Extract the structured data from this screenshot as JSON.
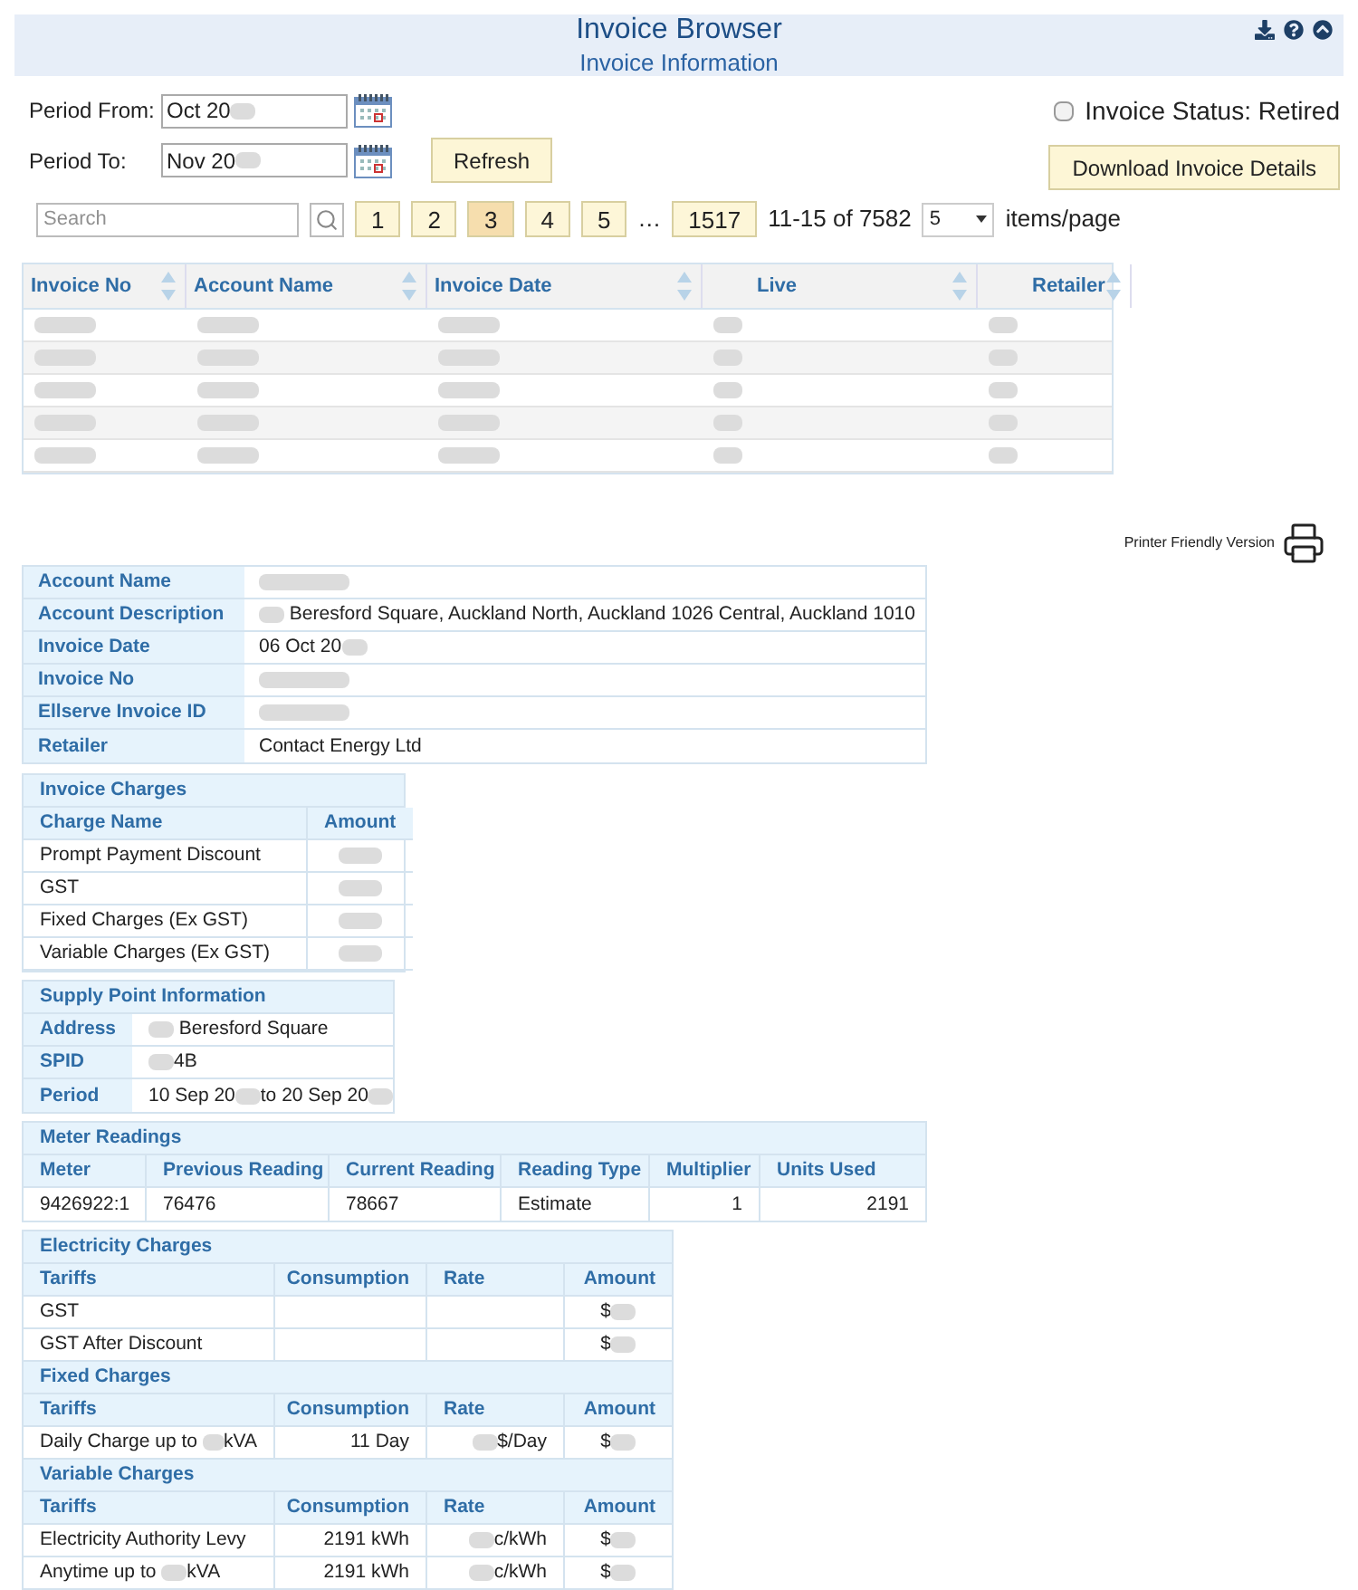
{
  "header": {
    "title": "Invoice Browser",
    "subtitle": "Invoice Information"
  },
  "filters": {
    "period_from": {
      "label": "Period From:",
      "value": [
        "Oct 20",
        {
          "kind": "blurred"
        }
      ]
    },
    "period_to": {
      "label": "Period To:",
      "value": [
        "Nov 20",
        {
          "kind": "blurred"
        }
      ]
    },
    "refresh": "Refresh",
    "status": {
      "label": "Invoice Status: Retired",
      "checked": false
    },
    "download": "Download Invoice Details"
  },
  "pager": {
    "search_placeholder": "Search",
    "pages": [
      {
        "label": "1",
        "selected": false
      },
      {
        "label": "2",
        "selected": false
      },
      {
        "label": "3",
        "selected": true
      },
      {
        "label": "4",
        "selected": false
      },
      {
        "label": "5",
        "selected": false
      }
    ],
    "ellipsis": "…",
    "last_page": {
      "label": "1517",
      "selected": false
    },
    "range": "11-15 of 7582",
    "page_size": "5",
    "page_size_suffix": "items/page"
  },
  "table": {
    "columns": [
      "Invoice No",
      "Account Name",
      "Invoice Date",
      "Live",
      "Retailer"
    ],
    "rows": [
      [
        {
          "kind": "blurred"
        },
        {
          "kind": "blurred"
        },
        {
          "kind": "blurred"
        },
        {
          "kind": "blurred"
        },
        {
          "kind": "blurred"
        }
      ],
      [
        {
          "kind": "blurred"
        },
        {
          "kind": "blurred"
        },
        {
          "kind": "blurred"
        },
        {
          "kind": "blurred"
        },
        {
          "kind": "blurred"
        }
      ],
      [
        {
          "kind": "blurred"
        },
        {
          "kind": "blurred"
        },
        {
          "kind": "blurred"
        },
        {
          "kind": "blurred"
        },
        {
          "kind": "blurred"
        }
      ],
      [
        {
          "kind": "blurred"
        },
        {
          "kind": "blurred"
        },
        {
          "kind": "blurred"
        },
        {
          "kind": "blurred"
        },
        {
          "kind": "blurred"
        }
      ],
      [
        {
          "kind": "blurred"
        },
        {
          "kind": "blurred"
        },
        {
          "kind": "blurred"
        },
        {
          "kind": "blurred"
        },
        {
          "kind": "blurred"
        }
      ]
    ]
  },
  "printer": "Printer Friendly Version",
  "account": [
    {
      "label": "Account Name",
      "value": {
        "kind": "blurred"
      }
    },
    {
      "label": "Account Description",
      "value": [
        {
          "kind": "blurred"
        },
        " Beresford Square, Auckland North, Auckland 1026 Central, Auckland 1010"
      ]
    },
    {
      "label": "Invoice Date",
      "value": [
        "06 Oct 20",
        {
          "kind": "blurred"
        }
      ]
    },
    {
      "label": "Invoice No",
      "value": {
        "kind": "blurred"
      }
    },
    {
      "label": "Ellserve Invoice ID",
      "value": {
        "kind": "blurred"
      }
    },
    {
      "label": "Retailer",
      "value": "Contact Energy Ltd"
    }
  ],
  "invoice_charges": {
    "title": "Invoice Charges",
    "columns": [
      "Charge Name",
      "Amount"
    ],
    "rows": [
      [
        "Prompt Payment Discount",
        {
          "kind": "blurred"
        }
      ],
      [
        "GST",
        {
          "kind": "blurred"
        }
      ],
      [
        "Fixed Charges (Ex GST)",
        {
          "kind": "blurred"
        }
      ],
      [
        "Variable Charges (Ex GST)",
        {
          "kind": "blurred"
        }
      ]
    ]
  },
  "supply_point": {
    "title": "Supply Point Information",
    "rows": [
      {
        "label": "Address",
        "value": [
          {
            "kind": "blurred"
          },
          " Beresford Square"
        ]
      },
      {
        "label": "SPID",
        "value": [
          {
            "kind": "blurred"
          },
          "4B"
        ]
      },
      {
        "label": "Period",
        "value": [
          "10 Sep 20",
          {
            "kind": "blurred"
          },
          "to 20 Sep 20",
          {
            "kind": "blurred"
          }
        ]
      }
    ]
  },
  "meter_readings": {
    "title": "Meter Readings",
    "columns": [
      "Meter",
      "Previous Reading",
      "Current Reading",
      "Reading Type",
      "Multiplier",
      "Units Used"
    ],
    "rows": [
      [
        "9426922:1",
        "76476",
        "78667",
        "Estimate",
        "1",
        "2191"
      ]
    ]
  },
  "charge_sections": [
    {
      "title": "Electricity Charges",
      "columns": [
        "Tariffs",
        "Consumption",
        "Rate",
        "Amount"
      ],
      "rows": [
        {
          "tariff": "GST",
          "amount": [
            "$",
            {
              "kind": "blurred"
            }
          ]
        },
        {
          "tariff": "GST After Discount",
          "amount": [
            "$",
            {
              "kind": "blurred"
            }
          ]
        }
      ]
    },
    {
      "title": "Fixed Charges",
      "columns": [
        "Tariffs",
        "Consumption",
        "Rate",
        "Amount"
      ],
      "rows": [
        {
          "tariff": [
            "Daily Charge up to ",
            {
              "kind": "blurred"
            },
            "kVA"
          ],
          "consumption": "11 Day",
          "rate": [
            {
              "kind": "blurred"
            },
            "$/Day"
          ],
          "amount": [
            "$",
            {
              "kind": "blurred"
            }
          ]
        }
      ]
    },
    {
      "title": "Variable Charges",
      "columns": [
        "Tariffs",
        "Consumption",
        "Rate",
        "Amount"
      ],
      "rows": [
        {
          "tariff": "Electricity Authority Levy",
          "consumption": "2191 kWh",
          "rate": [
            {
              "kind": "blurred"
            },
            "c/kWh"
          ],
          "amount": [
            "$",
            {
              "kind": "blurred"
            }
          ]
        },
        {
          "tariff": [
            "Anytime up to ",
            {
              "kind": "blurred"
            },
            "kVA"
          ],
          "consumption": "2191 kWh",
          "rate": [
            {
              "kind": "blurred"
            },
            "c/kWh"
          ],
          "amount": [
            "$",
            {
              "kind": "blurred"
            }
          ]
        }
      ]
    }
  ]
}
